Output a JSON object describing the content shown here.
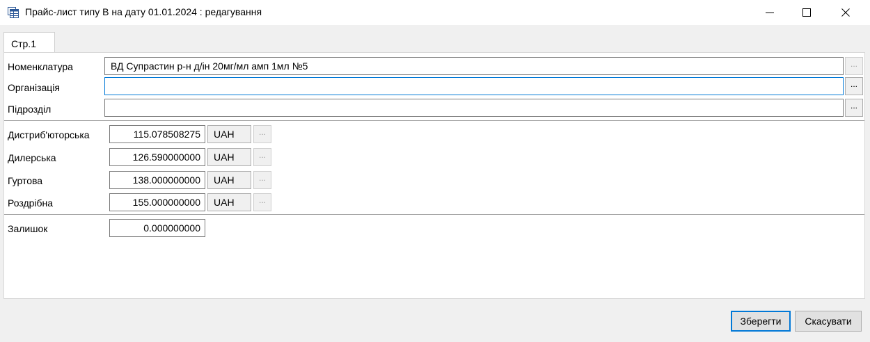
{
  "window": {
    "title": "Прайс-лист типу В на дату 01.01.2024 : редагування",
    "icon": "table-window-icon",
    "controls": {
      "minimize": "minimize-icon",
      "maximize": "maximize-icon",
      "close": "close-icon"
    }
  },
  "tabs": [
    {
      "label": "Стр.1",
      "active": true
    }
  ],
  "form": {
    "nomenclature": {
      "label": "Номенклатура",
      "value": "ВД Супрастин р-н д/ін 20мг/мл амп 1мл №5"
    },
    "organization": {
      "label": "Організація",
      "value": ""
    },
    "subdivision": {
      "label": "Підрозділ",
      "value": ""
    },
    "browse_label": "...",
    "prices": [
      {
        "label": "Дистриб'юторська",
        "value": "115.078508275",
        "currency": "UAH"
      },
      {
        "label": "Дилерська",
        "value": "126.590000000",
        "currency": "UAH"
      },
      {
        "label": "Гуртова",
        "value": "138.000000000",
        "currency": "UAH"
      },
      {
        "label": "Роздрібна",
        "value": "155.000000000",
        "currency": "UAH"
      }
    ],
    "stock": {
      "label": "Залишок",
      "value": "0.000000000"
    }
  },
  "buttons": {
    "save": "Зберегти",
    "cancel": "Скасувати"
  },
  "colors": {
    "focus_border": "#0078d7",
    "window_bg": "#f0f0f0",
    "panel_bg": "#ffffff"
  }
}
